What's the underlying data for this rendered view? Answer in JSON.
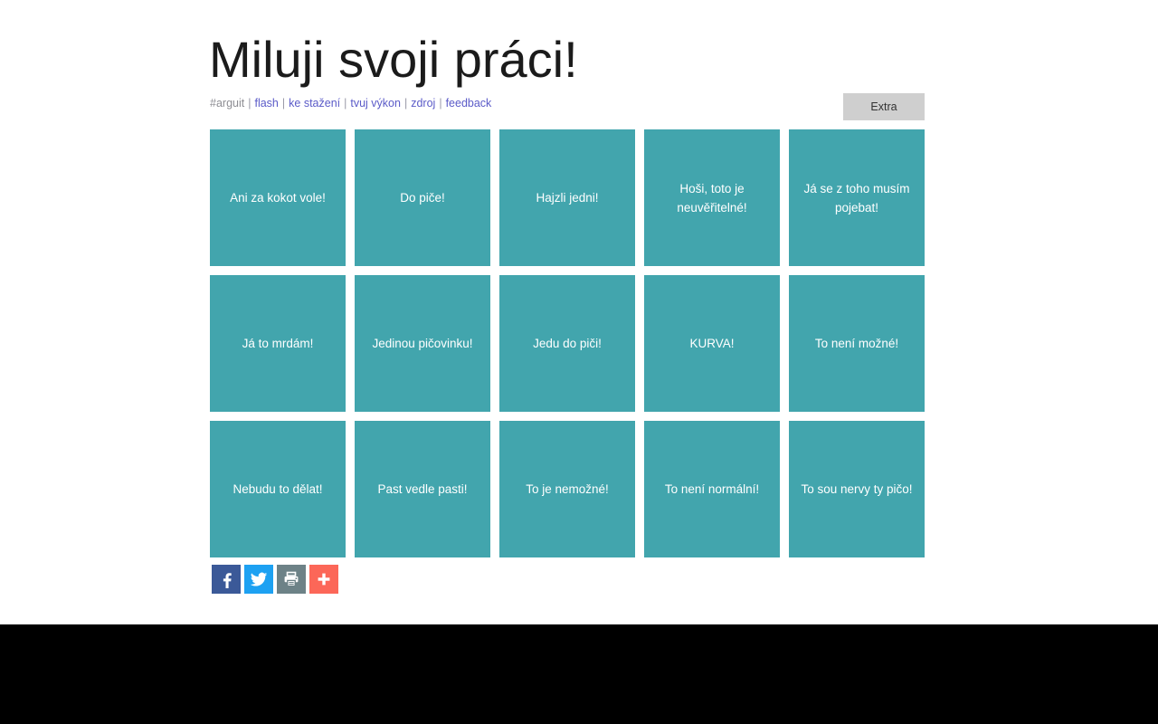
{
  "header": {
    "title": "Miluji svoji práci!",
    "nav": {
      "separator": "|",
      "items": [
        {
          "label": "#arguit",
          "style": "muted"
        },
        {
          "label": "flash",
          "style": "link"
        },
        {
          "label": "ke stažení",
          "style": "link"
        },
        {
          "label": "tvuj výkon",
          "style": "link"
        },
        {
          "label": "zdroj",
          "style": "link"
        },
        {
          "label": "feedback",
          "style": "link"
        }
      ]
    },
    "extra_button_label": "Extra"
  },
  "tiles": [
    {
      "label": "Ani za kokot vole!"
    },
    {
      "label": "Do piče!"
    },
    {
      "label": "Hajzli jedni!"
    },
    {
      "label": "Hoši, toto je neuvěřitelné!"
    },
    {
      "label": "Já se z toho musím pojebat!"
    },
    {
      "label": "Já to mrdám!"
    },
    {
      "label": "Jedinou pičovinku!"
    },
    {
      "label": "Jedu do piči!"
    },
    {
      "label": "KURVA!"
    },
    {
      "label": "To není možné!"
    },
    {
      "label": "Nebudu to dělat!"
    },
    {
      "label": "Past vedle pasti!"
    },
    {
      "label": "To je nemožné!"
    },
    {
      "label": "To není normální!"
    },
    {
      "label": "To sou nervy ty pičo!"
    }
  ],
  "share": {
    "buttons": [
      {
        "icon": "facebook-icon",
        "name": "Facebook"
      },
      {
        "icon": "twitter-icon",
        "name": "Twitter"
      },
      {
        "icon": "print-icon",
        "name": "Print"
      },
      {
        "icon": "plus-icon",
        "name": "More"
      }
    ]
  },
  "colors": {
    "tile": "#42a5ad",
    "facebook": "#3b5998",
    "twitter": "#1da1f2",
    "print": "#6d8287",
    "more": "#fc6758",
    "link": "#5b5bc8",
    "extra_button": "#cfcfcf",
    "bottom_band": "#000000"
  }
}
